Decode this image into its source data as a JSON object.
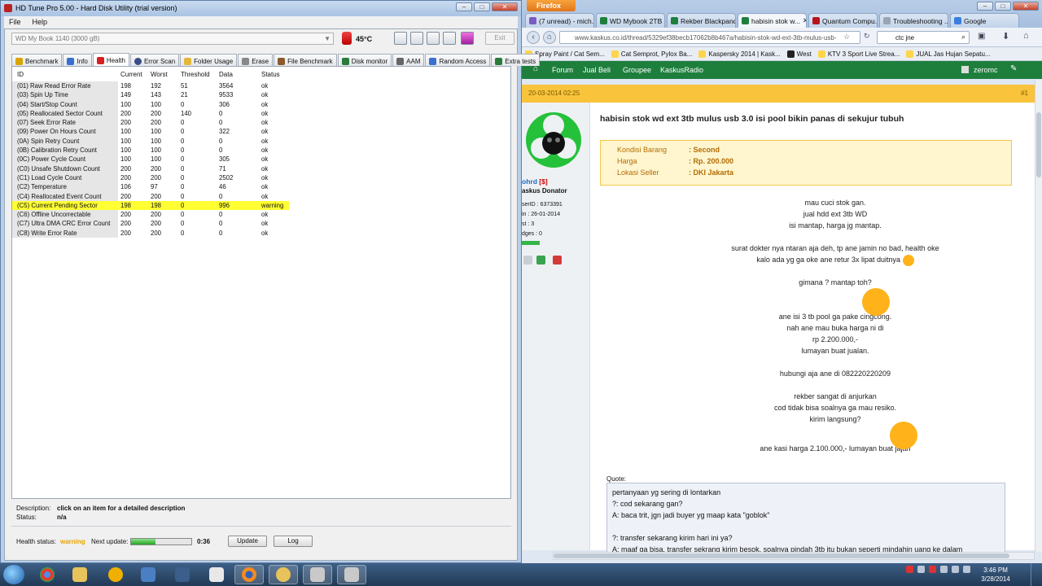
{
  "hdtune": {
    "title": "HD Tune Pro 5.00 - Hard Disk Utility (trial version)",
    "menu": [
      "File",
      "Help"
    ],
    "drive": "WD     My Book 1140    (3000 gB)",
    "temperature": "45°C",
    "exit_label": "Exit",
    "tabs": [
      "Benchmark",
      "Info",
      "Health",
      "Error Scan",
      "Folder Usage",
      "Erase",
      "File Benchmark",
      "Disk monitor",
      "AAM",
      "Random Access",
      "Extra tests"
    ],
    "columns": [
      "ID",
      "Current",
      "Worst",
      "Threshold",
      "Data",
      "Status"
    ],
    "rows": [
      {
        "id": "(01) Raw Read Error Rate",
        "current": "198",
        "worst": "192",
        "threshold": "51",
        "data": "3564",
        "status": "ok"
      },
      {
        "id": "(03) Spin Up Time",
        "current": "149",
        "worst": "143",
        "threshold": "21",
        "data": "9533",
        "status": "ok"
      },
      {
        "id": "(04) Start/Stop Count",
        "current": "100",
        "worst": "100",
        "threshold": "0",
        "data": "306",
        "status": "ok"
      },
      {
        "id": "(05) Reallocated Sector Count",
        "current": "200",
        "worst": "200",
        "threshold": "140",
        "data": "0",
        "status": "ok"
      },
      {
        "id": "(07) Seek Error Rate",
        "current": "200",
        "worst": "200",
        "threshold": "0",
        "data": "0",
        "status": "ok"
      },
      {
        "id": "(09) Power On Hours Count",
        "current": "100",
        "worst": "100",
        "threshold": "0",
        "data": "322",
        "status": "ok"
      },
      {
        "id": "(0A) Spin Retry Count",
        "current": "100",
        "worst": "100",
        "threshold": "0",
        "data": "0",
        "status": "ok"
      },
      {
        "id": "(0B) Calibration Retry Count",
        "current": "100",
        "worst": "100",
        "threshold": "0",
        "data": "0",
        "status": "ok"
      },
      {
        "id": "(0C) Power Cycle Count",
        "current": "100",
        "worst": "100",
        "threshold": "0",
        "data": "305",
        "status": "ok"
      },
      {
        "id": "(C0) Unsafe Shutdown Count",
        "current": "200",
        "worst": "200",
        "threshold": "0",
        "data": "71",
        "status": "ok"
      },
      {
        "id": "(C1) Load Cycle Count",
        "current": "200",
        "worst": "200",
        "threshold": "0",
        "data": "2502",
        "status": "ok"
      },
      {
        "id": "(C2) Temperature",
        "current": "106",
        "worst": "97",
        "threshold": "0",
        "data": "46",
        "status": "ok"
      },
      {
        "id": "(C4) Reallocated Event Count",
        "current": "200",
        "worst": "200",
        "threshold": "0",
        "data": "0",
        "status": "ok"
      },
      {
        "id": "(C5) Current Pending Sector",
        "current": "198",
        "worst": "198",
        "threshold": "0",
        "data": "996",
        "status": "warning"
      },
      {
        "id": "(C6) Offline Uncorrectable",
        "current": "200",
        "worst": "200",
        "threshold": "0",
        "data": "0",
        "status": "ok"
      },
      {
        "id": "(C7) Ultra DMA CRC Error Count",
        "current": "200",
        "worst": "200",
        "threshold": "0",
        "data": "0",
        "status": "ok"
      },
      {
        "id": "(C8) Write Error Rate",
        "current": "200",
        "worst": "200",
        "threshold": "0",
        "data": "0",
        "status": "ok"
      }
    ],
    "description_label": "Description:",
    "description_value": "click on an item for a detailed description",
    "status_label": "Status:",
    "status_value": "n/a",
    "health_label": "Health status:",
    "health_value": "warning",
    "next_update_label": "Next update:",
    "next_update_progress": 0.4,
    "next_update_time": "0:36",
    "update_label": "Update",
    "log_label": "Log",
    "warning_color": "#ffff33"
  },
  "firefox": {
    "menu_label": "Firefox",
    "tabs": [
      "(7 unread) - mich...",
      "WD Mybook 2TB ...",
      "Rekber Blackpand...",
      "habisin stok w...",
      "Quantum Compu...",
      "Troubleshooting ...",
      "Google"
    ],
    "active_tab": 3,
    "url": "www.kaskus.co.id/thread/5329ef38becb17062b8b467a/habisin-stok-wd-ext-3tb-mulus-usb-",
    "search_value": "ctc jne",
    "bookmarks": [
      "Spray Paint / Cat Sem...",
      "Cat Semprot, Pylox Ba...",
      "Kaspersky 2014 | Kask...",
      "West",
      "KTV 3 Sport Live Strea...",
      "JUAL Jas Hujan Sepatu..."
    ],
    "nav": [
      "Forum",
      "Jual Beli",
      "Groupee",
      "KaskusRadio"
    ],
    "user_menu": "zeromc",
    "post_date": "20-03-2014 02:25",
    "post_number": "#1",
    "user": {
      "name": "ohrd",
      "badge": "[$]",
      "rank": "askus Donator",
      "lines": [
        "serID : 6373391",
        "in : 26-01-2014",
        "st : 3",
        "dges : 0"
      ]
    },
    "thread_title": "habisin stok wd ext 3tb mulus usb 3.0 isi pool bikin panas di sekujur tubuh",
    "info": [
      {
        "k": "Kondisi Barang",
        "v": ": Second"
      },
      {
        "k": "Harga",
        "v": ": Rp. 200.000"
      },
      {
        "k": "Lokasi Seller",
        "v": ": DKI Jakarta"
      }
    ],
    "post_lines": [
      "mau cuci stok gan.",
      "jual hdd ext 3tb WD",
      "isi mantap, harga jg mantap.",
      "",
      "surat dokter nya ntaran aja deh, tp ane jamin no bad, health oke",
      "kalo ada yg ga oke ane retur 3x lipat duitnya",
      "",
      "gimana ? mantap toh?",
      "",
      "ane isi 3 tb pool ga pake cingcong.",
      "nah ane mau buka harga ni di",
      "rp 2.200.000,-",
      "lumayan buat jualan.",
      "",
      "hubungi aja ane di 082220220209",
      "",
      "rekber sangat di anjurkan",
      "cod tidak bisa soalnya ga mau resiko.",
      "kirim langsung?",
      "",
      "ane kasi harga 2.100.000,- lumayan buat jajan"
    ],
    "quote_label": "Quote:",
    "quote_lines": [
      "pertanyaan yg sering di lontarkan",
      "?: cod sekarang gan?",
      "A: baca trit, jgn jadi buyer yg maap kata \"goblok\"",
      "",
      "?: transfer sekarang kirim hari ini ya?",
      "A: maaf ga bisa, transfer sekrang kirim besok, soalnya pindah 3tb itu bukan seperti mindahin uang ke dalam"
    ],
    "kaskus_green": "#1e7f3d"
  },
  "taskbar": {
    "time": "3:46 PM",
    "date": "3/28/2014"
  }
}
